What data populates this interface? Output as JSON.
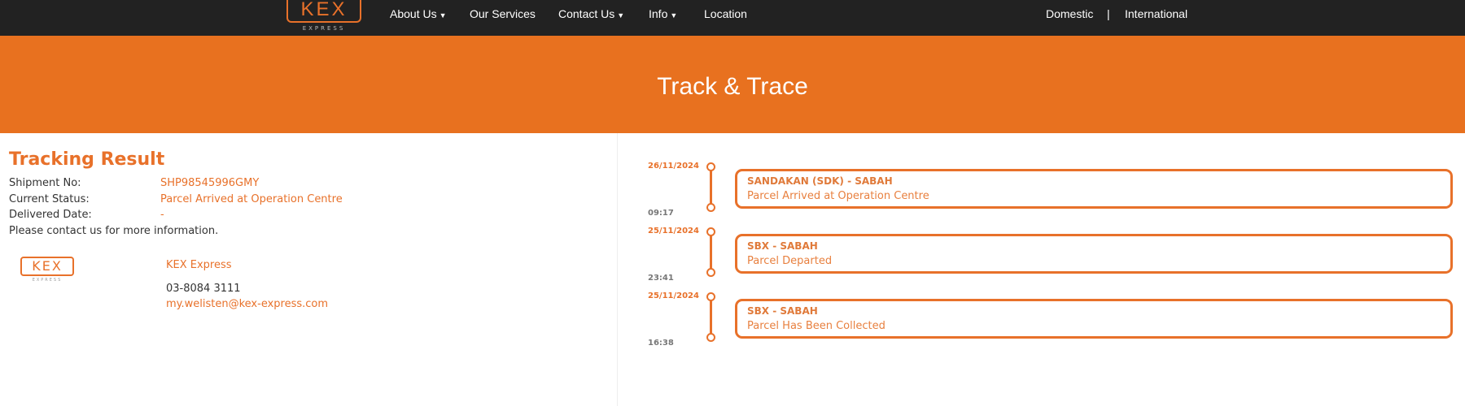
{
  "nav": {
    "logo_text": "KEX",
    "logo_sub": "EXPRESS",
    "items": [
      {
        "label": "About Us",
        "dropdown": true
      },
      {
        "label": "Our Services",
        "dropdown": false
      },
      {
        "label": "Contact Us",
        "dropdown": true
      },
      {
        "label": "Info",
        "dropdown": true
      },
      {
        "label": "Location",
        "dropdown": false
      }
    ],
    "domestic": "Domestic",
    "separator": "|",
    "international": "International"
  },
  "banner": {
    "title": "Track & Trace"
  },
  "result": {
    "title": "Tracking Result",
    "shipment_label": "Shipment No:",
    "shipment_value": "SHP98545996GMY",
    "status_label": "Current Status:",
    "status_value": "Parcel Arrived at Operation Centre",
    "delivered_label": "Delivered Date:",
    "delivered_value": "-",
    "note": "Please contact us for more information."
  },
  "contact": {
    "logo_text": "KEX",
    "logo_sub": "EXPRESS",
    "company": "KEX Express",
    "phone": "03-8084 3111",
    "email": "my.welisten@kex-express.com"
  },
  "timeline": [
    {
      "date": "26/11/2024",
      "time": "09:17",
      "location": "SANDAKAN (SDK) - SABAH",
      "status": "Parcel Arrived at Operation Centre"
    },
    {
      "date": "25/11/2024",
      "time": "23:41",
      "location": "SBX - SABAH",
      "status": "Parcel Departed"
    },
    {
      "date": "25/11/2024",
      "time": "16:38",
      "location": "SBX - SABAH",
      "status": "Parcel Has Been Collected"
    }
  ],
  "colors": {
    "accent": "#e8711f",
    "nav_bg": "#222222"
  }
}
